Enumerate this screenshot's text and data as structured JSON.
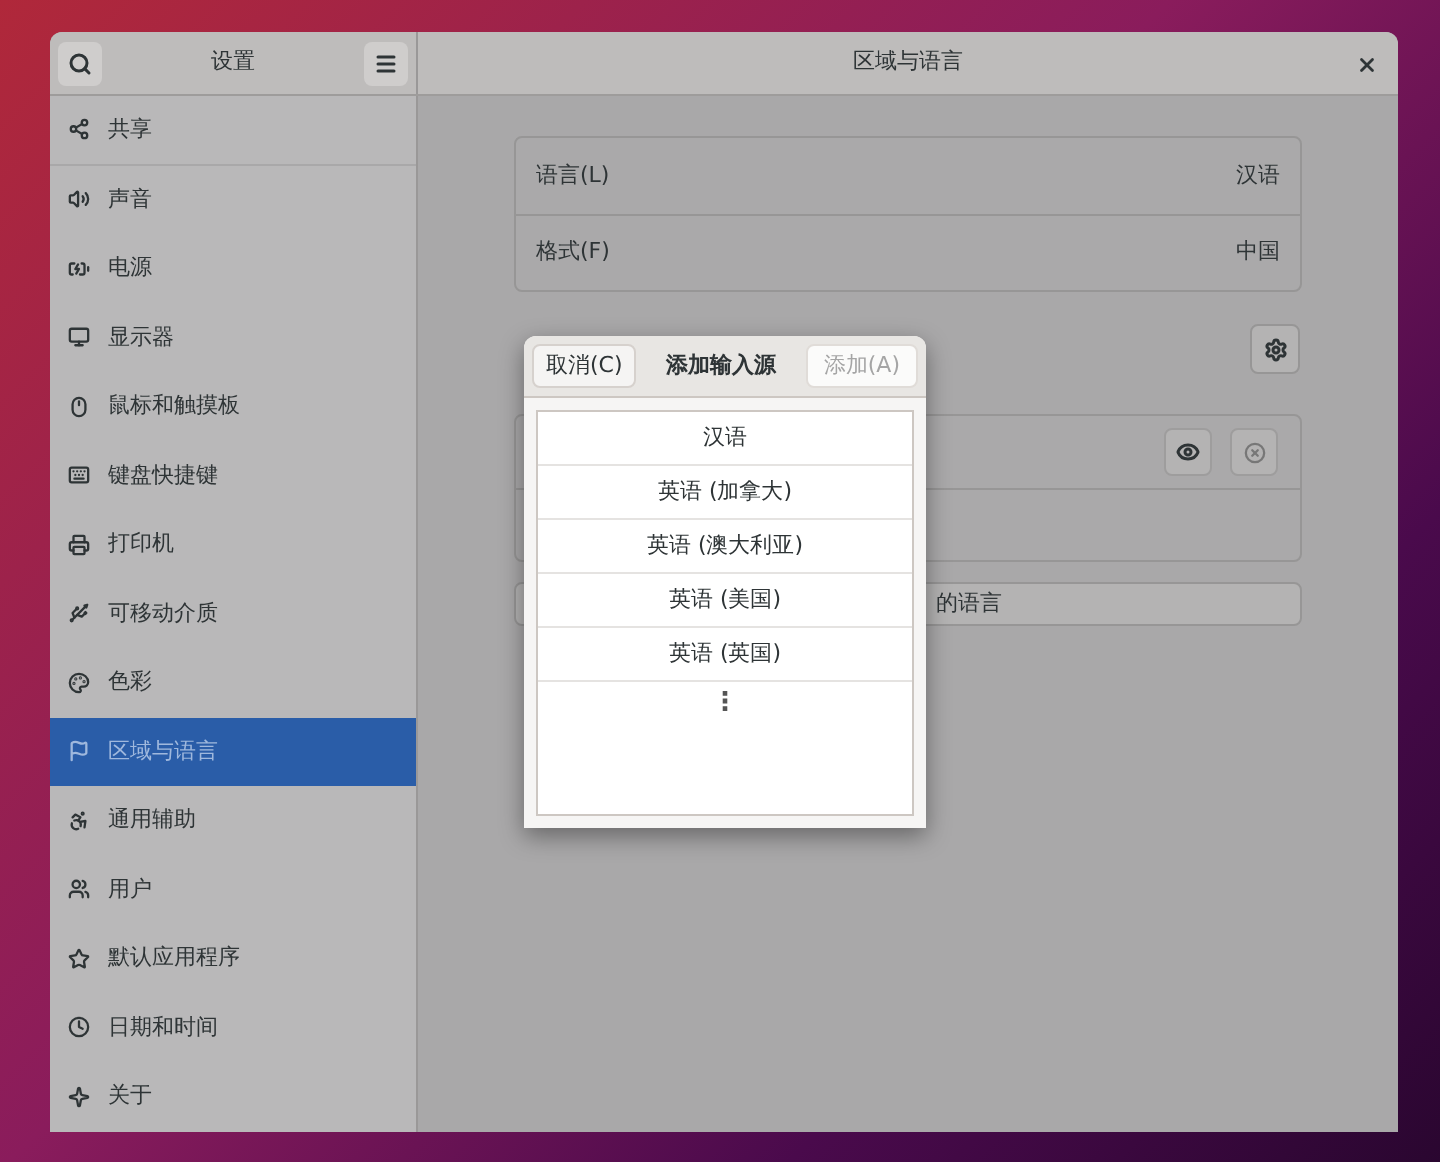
{
  "sidebar": {
    "title": "设置",
    "items": [
      {
        "label": "共享",
        "selected": false
      },
      {
        "label": "声音",
        "selected": false
      },
      {
        "label": "电源",
        "selected": false
      },
      {
        "label": "显示器",
        "selected": false
      },
      {
        "label": "鼠标和触摸板",
        "selected": false
      },
      {
        "label": "键盘快捷键",
        "selected": false
      },
      {
        "label": "打印机",
        "selected": false
      },
      {
        "label": "可移动介质",
        "selected": false
      },
      {
        "label": "色彩",
        "selected": false
      },
      {
        "label": "区域与语言",
        "selected": true
      },
      {
        "label": "通用辅助",
        "selected": false
      },
      {
        "label": "用户",
        "selected": false
      },
      {
        "label": "默认应用程序",
        "selected": false
      },
      {
        "label": "日期和时间",
        "selected": false
      },
      {
        "label": "关于",
        "selected": false
      }
    ]
  },
  "window": {
    "title": "区域与语言"
  },
  "settings": [
    {
      "label": "语言(L)",
      "value": "汉语"
    },
    {
      "label": "格式(F)",
      "value": "中国"
    }
  ],
  "input_sources": {
    "button_text": "的语言"
  },
  "dialog": {
    "cancel": "取消(C)",
    "title": "添加输入源",
    "add": "添加(A)",
    "add_disabled": true,
    "items": [
      "汉语",
      "英语 (加拿大)",
      "英语 (澳大利亚)",
      "英语 (美国)",
      "英语 (英国)"
    ],
    "more": "⋮"
  }
}
